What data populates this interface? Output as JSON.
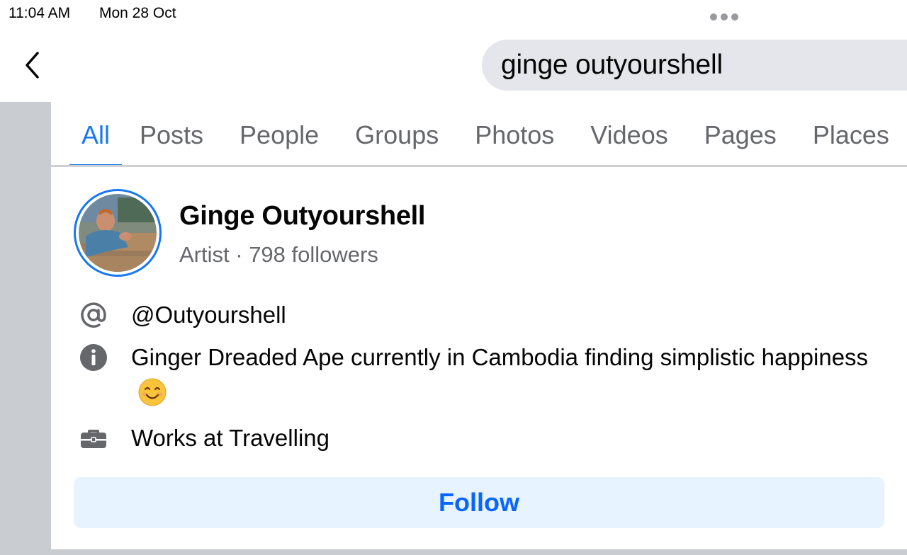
{
  "status_bar": {
    "time": "11:04 AM",
    "date": "Mon 28 Oct"
  },
  "search": {
    "query": "ginge outyourshell"
  },
  "tabs": [
    {
      "label": "All",
      "active": true
    },
    {
      "label": "Posts",
      "active": false
    },
    {
      "label": "People",
      "active": false
    },
    {
      "label": "Groups",
      "active": false
    },
    {
      "label": "Photos",
      "active": false
    },
    {
      "label": "Videos",
      "active": false
    },
    {
      "label": "Pages",
      "active": false
    },
    {
      "label": "Places",
      "active": false
    }
  ],
  "result": {
    "name": "Ginge Outyourshell",
    "category": "Artist",
    "separator": " · ",
    "followers": "798 followers",
    "username": "@Outyourshell",
    "bio": "Ginger Dreaded Ape currently in Cambodia finding simplistic happiness",
    "bio_emoji": "smiling-face-emoji",
    "work": "Works at Travelling",
    "follow_label": "Follow"
  },
  "colors": {
    "accent": "#1877f2",
    "follow_bg": "#e7f3ff",
    "follow_text": "#0866ff",
    "secondary_text": "#65676b",
    "search_bg": "#e4e6eb",
    "gutter": "#c9ccd1"
  },
  "icons": {
    "back": "chevron-left-icon",
    "username": "at-sign-icon",
    "bio": "info-icon",
    "work": "briefcase-icon"
  }
}
